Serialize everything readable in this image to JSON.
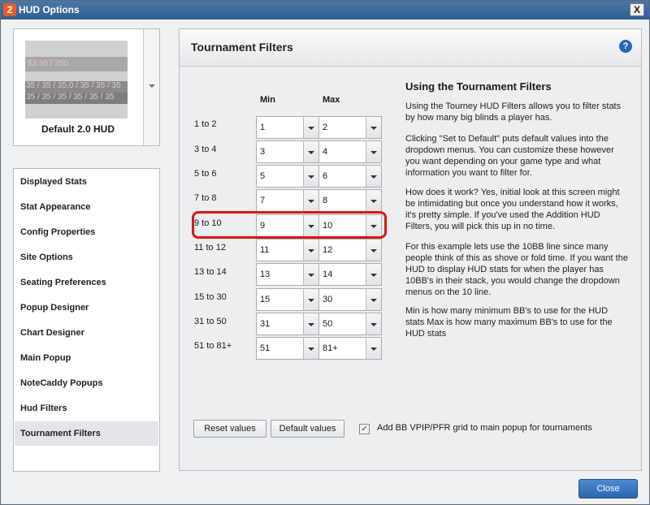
{
  "window": {
    "title": "HUD Options",
    "app_icon": "2",
    "close_glyph": "X"
  },
  "preview": {
    "row1": "$3.50 / 350",
    "row2": "35 / 35 / 35.0 / 35 / 35 / 35",
    "row3": "35 / 35 / 35 / 35 / 35 / 35",
    "label": "Default 2.0 HUD"
  },
  "sidebar": {
    "items": [
      {
        "label": "Displayed Stats"
      },
      {
        "label": "Stat Appearance"
      },
      {
        "label": "Config Properties"
      },
      {
        "label": "Site Options"
      },
      {
        "label": "Seating Preferences"
      },
      {
        "label": "Popup Designer"
      },
      {
        "label": "Chart Designer"
      },
      {
        "label": "Main Popup"
      },
      {
        "label": "NoteCaddy Popups"
      },
      {
        "label": "Hud Filters"
      },
      {
        "label": "Tournament Filters"
      }
    ],
    "active_index": 10
  },
  "main": {
    "title": "Tournament Filters",
    "help_glyph": "?",
    "min_header": "Min",
    "max_header": "Max",
    "filters": [
      {
        "label": "1 to 2",
        "min": "1",
        "max": "2"
      },
      {
        "label": "3 to 4",
        "min": "3",
        "max": "4"
      },
      {
        "label": "5 to 6",
        "min": "5",
        "max": "6"
      },
      {
        "label": "7 to 8",
        "min": "7",
        "max": "8"
      },
      {
        "label": "9 to 10",
        "min": "9",
        "max": "10"
      },
      {
        "label": "11 to 12",
        "min": "11",
        "max": "12"
      },
      {
        "label": "13 to 14",
        "min": "13",
        "max": "14"
      },
      {
        "label": "15 to 30",
        "min": "15",
        "max": "30"
      },
      {
        "label": "31 to 50",
        "min": "31",
        "max": "50"
      },
      {
        "label": "51 to 81+",
        "min": "51",
        "max": "81+"
      }
    ],
    "info_title": "Using the Tournament Filters",
    "info_paragraphs": [
      "Using the Tourney HUD Filters allows you to filter stats by how many big blinds a player has.",
      "Clicking \"Set to Default\" puts default values into the dropdown menus. You can customize these however you want depending on your game type and what information you want to filter for.",
      "How does it work? Yes, initial look at this screen might be intimidating but once you understand how it works, it's pretty simple. If you've used the Addition HUD Filters, you will pick this up in no time.",
      "For this example lets use the 10BB line since many people think of this as shove or fold time. If you want the HUD to display HUD stats for when the player has 10BB's in their stack, you would change the dropdown menus on the 10 line.",
      "Min is how many minimum BB's to use for the HUD stats Max is how many maximum BB's to use for the HUD stats"
    ],
    "reset_label": "Reset values",
    "default_label": "Default values",
    "checkbox_checked": true,
    "checkbox_mark": "✓",
    "checkbox_label": "Add BB VPIP/PFR grid to main popup for tournaments"
  },
  "footer": {
    "close_label": "Close"
  }
}
